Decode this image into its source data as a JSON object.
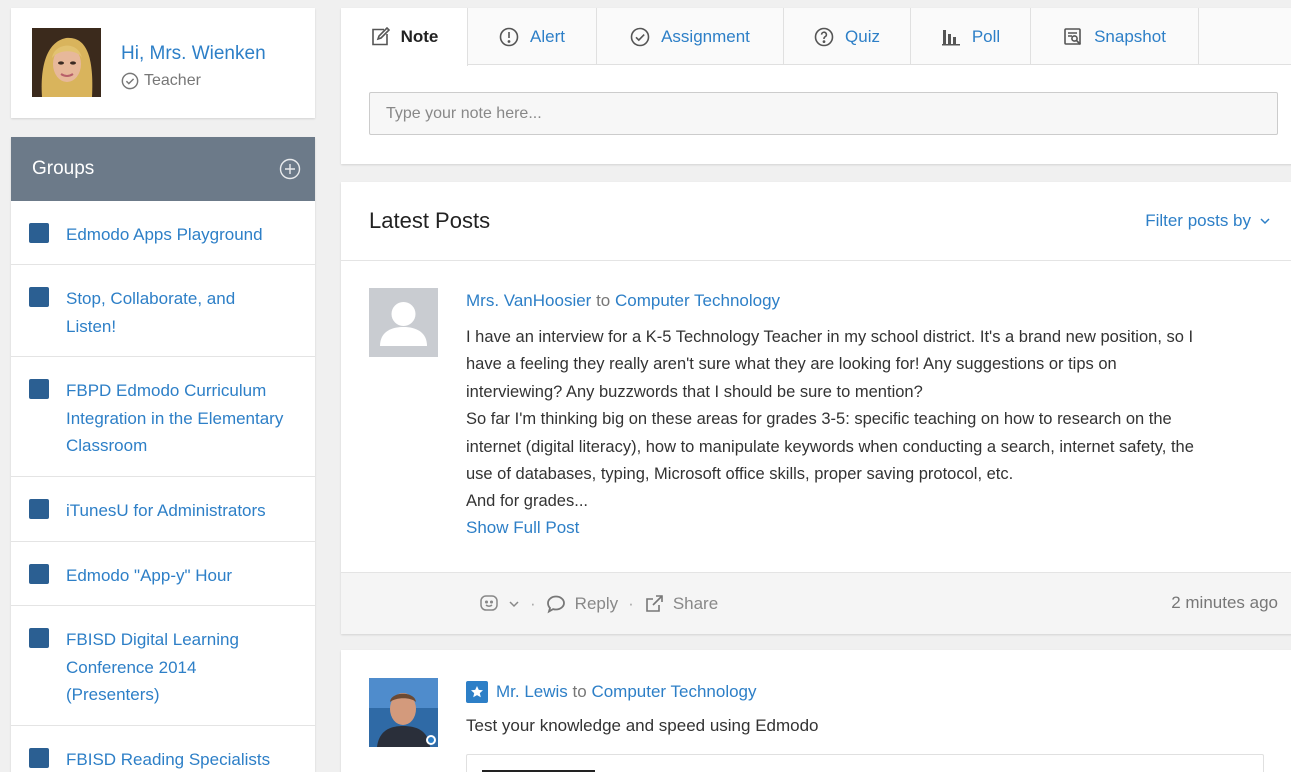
{
  "profile": {
    "greeting": "Hi, Mrs. Wienken",
    "role": "Teacher"
  },
  "groups": {
    "title": "Groups",
    "items": [
      {
        "label": "Edmodo Apps Playground"
      },
      {
        "label": "Stop, Collaborate, and Listen!"
      },
      {
        "label": "FBPD Edmodo Curriculum Integration in the Elementary Classroom"
      },
      {
        "label": "iTunesU for Administrators"
      },
      {
        "label": "Edmodo \"App-y\" Hour"
      },
      {
        "label": "FBISD Digital Learning Conference 2014 (Presenters)"
      },
      {
        "label": "FBISD Reading Specialists"
      }
    ],
    "swatch_color": "#2b5f92"
  },
  "composer": {
    "tabs": [
      {
        "label": "Note",
        "icon": "note-icon"
      },
      {
        "label": "Alert",
        "icon": "alert-icon"
      },
      {
        "label": "Assignment",
        "icon": "assignment-icon"
      },
      {
        "label": "Quiz",
        "icon": "quiz-icon"
      },
      {
        "label": "Poll",
        "icon": "poll-icon"
      },
      {
        "label": "Snapshot",
        "icon": "snapshot-icon"
      }
    ],
    "placeholder": "Type your note here..."
  },
  "posts": {
    "title": "Latest Posts",
    "filter_label": "Filter posts by",
    "first": {
      "author": "Mrs. VanHoosier",
      "to_word": "to",
      "group": "Computer Technology",
      "body_lines": [
        "I have an interview for a K-5 Technology Teacher in my school district. It's a brand new position, so I",
        "have a feeling they really aren't sure what they are looking for! Any suggestions or tips on",
        "interviewing? Any buzzwords that I should be sure to mention?",
        "So far I'm thinking big on these areas for grades 3-5: specific teaching on how to research on the",
        "internet (digital literacy), how to manipulate keywords when conducting a search, internet safety, the",
        "use of databases, typing, Microsoft office skills, proper saving protocol, etc.",
        "And for grades..."
      ],
      "show_full": "Show Full Post",
      "reply_label": "Reply",
      "share_label": "Share",
      "dot": "·",
      "timestamp": "2 minutes ago"
    },
    "second": {
      "author": "Mr. Lewis",
      "to_word": "to",
      "group": "Computer Technology",
      "body": "Test your knowledge and speed using Edmodo"
    }
  },
  "colors": {
    "accent": "#2d7fc7",
    "groups_header": "#6c7a89",
    "background": "#f0f0f0"
  }
}
